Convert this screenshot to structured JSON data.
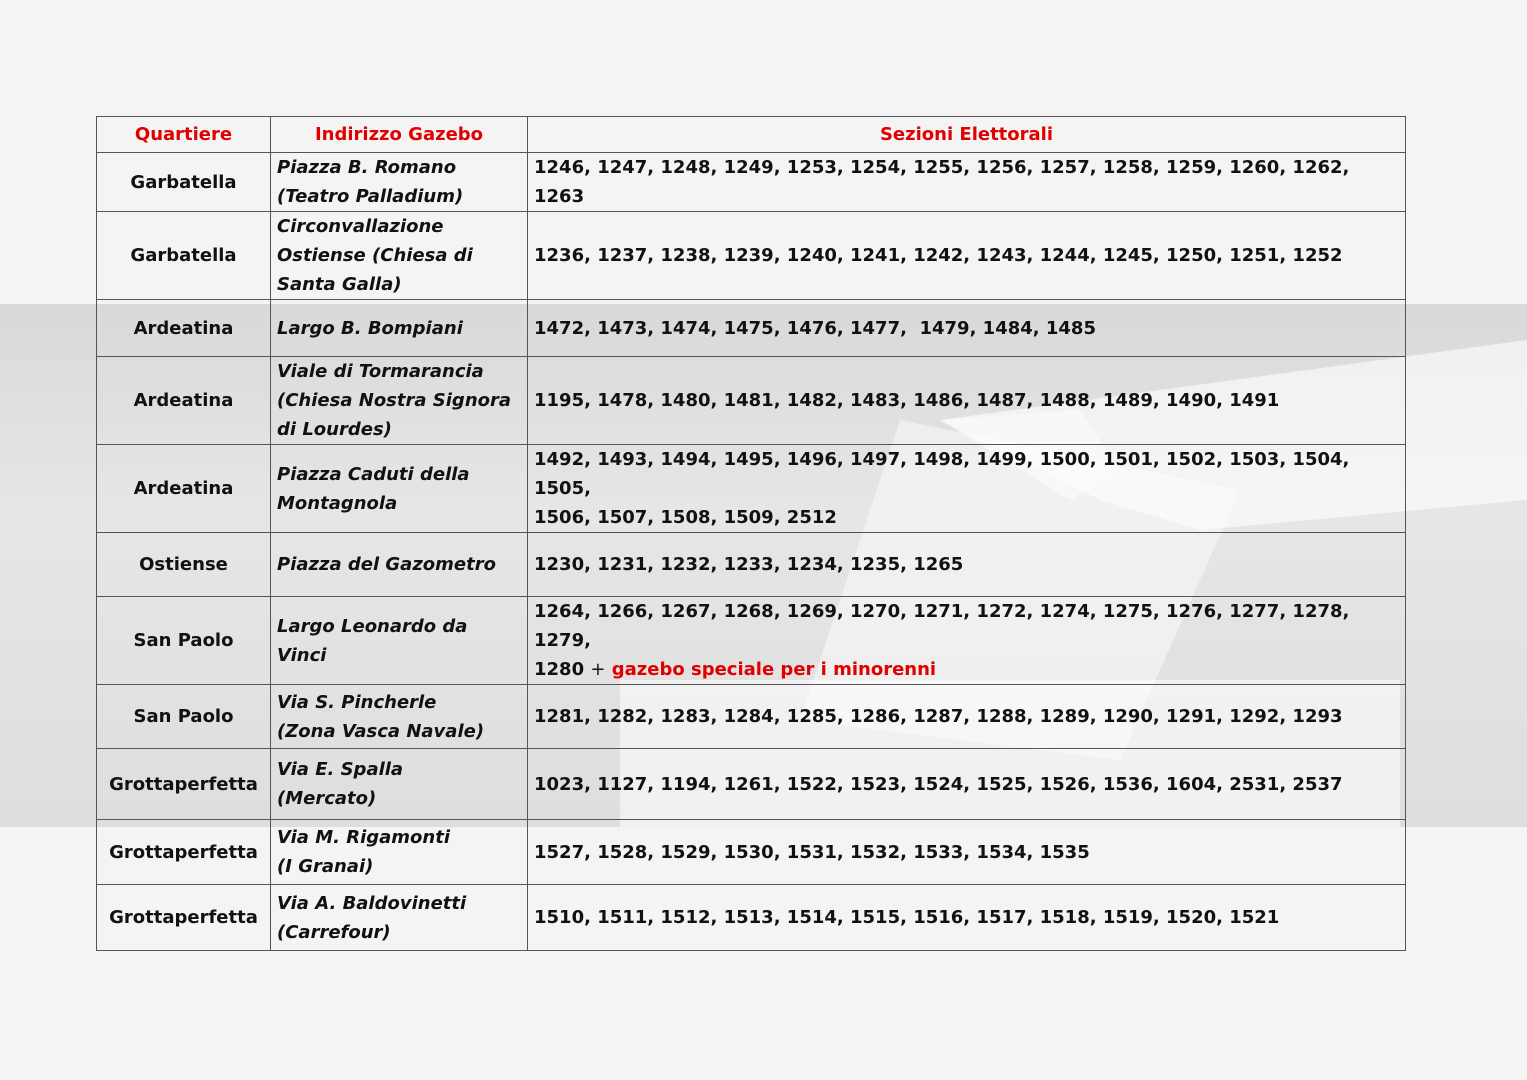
{
  "table": {
    "headers": [
      "Quartiere",
      "Indirizzo Gazebo",
      "Sezioni Elettorali"
    ],
    "rows": [
      {
        "quartiere": "Garbatella",
        "address": [
          "Piazza B. Romano",
          "(Teatro Palladium)"
        ],
        "sections": [
          "1246, 1247, 1248, 1249, 1253, 1254, 1255, 1256, 1257, 1258, 1259, 1260, 1262, 1263"
        ]
      },
      {
        "quartiere": "Garbatella",
        "address": [
          "Circonvallazione",
          "Ostiense (Chiesa di",
          "Santa Galla)"
        ],
        "sections": [
          "1236, 1237, 1238, 1239, 1240, 1241, 1242, 1243, 1244, 1245, 1250, 1251, 1252"
        ]
      },
      {
        "quartiere": "Ardeatina",
        "address": [
          "Largo B. Bompiani"
        ],
        "sections": [
          "1472, 1473, 1474, 1475, 1476, 1477,  1479, 1484, 1485"
        ]
      },
      {
        "quartiere": "Ardeatina",
        "address": [
          "Viale di Tormarancia",
          "(Chiesa Nostra Signora",
          "di Lourdes)"
        ],
        "sections": [
          "1195, 1478, 1480, 1481, 1482, 1483, 1486, 1487, 1488, 1489, 1490, 1491"
        ]
      },
      {
        "quartiere": "Ardeatina",
        "address": [
          "Piazza Caduti della",
          "Montagnola"
        ],
        "sections": [
          "1492, 1493, 1494, 1495, 1496, 1497, 1498, 1499, 1500, 1501, 1502, 1503, 1504, 1505,",
          "1506, 1507, 1508, 1509, 2512"
        ]
      },
      {
        "quartiere": "Ostiense",
        "address": [
          "Piazza del Gazometro"
        ],
        "sections": [
          "1230, 1231, 1232, 1233, 1234, 1235, 1265"
        ]
      },
      {
        "quartiere": "San Paolo",
        "address": [
          "Largo Leonardo da",
          "Vinci"
        ],
        "sections": [
          "1264, 1266, 1267, 1268, 1269, 1270, 1271, 1272, 1274, 1275, 1276, 1277, 1278, 1279,",
          "1280"
        ],
        "special_note": "gazebo speciale per i minorenni"
      },
      {
        "quartiere": "San Paolo",
        "address": [
          "Via S. Pincherle",
          "(Zona Vasca Navale)"
        ],
        "sections": [
          "1281, 1282, 1283, 1284, 1285, 1286, 1287, 1288, 1289, 1290, 1291, 1292, 1293"
        ]
      },
      {
        "quartiere": "Grottaperfetta",
        "address": [
          "Via E. Spalla",
          "(Mercato)"
        ],
        "sections": [
          "1023, 1127, 1194, 1261, 1522, 1523, 1524, 1525, 1526, 1536, 1604, 2531, 2537"
        ]
      },
      {
        "quartiere": "Grottaperfetta",
        "address": [
          "Via M. Rigamonti",
          "(I Granai)"
        ],
        "sections": [
          "1527, 1528, 1529, 1530, 1531, 1532, 1533, 1534, 1535"
        ]
      },
      {
        "quartiere": "Grottaperfetta",
        "address": [
          "Via A. Baldovinetti",
          "(Carrefour)"
        ],
        "sections": [
          "1510, 1511, 1512, 1513, 1514, 1515, 1516, 1517, 1518, 1519, 1520, 1521"
        ]
      }
    ]
  },
  "colors": {
    "header_text": "#e00000",
    "special_note": "#e00000",
    "band": "#dedede",
    "background": "#f4f4f4"
  },
  "background_image": "hand-casting-ballot-icon"
}
